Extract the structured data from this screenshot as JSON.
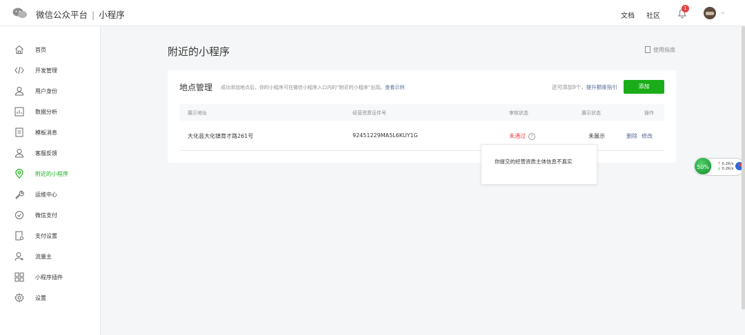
{
  "topbar": {
    "title": "微信公众平台",
    "separator": "|",
    "subtitle": "小程序",
    "docs": "文档",
    "community": "社区",
    "badge": "1"
  },
  "sidebar": {
    "items": [
      {
        "label": "首页",
        "icon": "home-icon"
      },
      {
        "label": "开发管理",
        "icon": "code-icon"
      },
      {
        "label": "用户身份",
        "icon": "user-icon"
      },
      {
        "label": "数据分析",
        "icon": "chart-icon"
      },
      {
        "label": "模板消息",
        "icon": "message-icon"
      },
      {
        "label": "客服反馈",
        "icon": "support-icon"
      },
      {
        "label": "附近的小程序",
        "icon": "location-icon",
        "active": true
      },
      {
        "label": "运维中心",
        "icon": "wrench-icon"
      },
      {
        "label": "微信支付",
        "icon": "pay-icon"
      },
      {
        "label": "支付设置",
        "icon": "pay-settings-icon"
      },
      {
        "label": "流量主",
        "icon": "traffic-icon"
      },
      {
        "label": "小程序插件",
        "icon": "plugin-icon"
      },
      {
        "label": "设置",
        "icon": "gear-icon"
      }
    ]
  },
  "page": {
    "title": "附近的小程序",
    "guide": "使用指南"
  },
  "card": {
    "title": "地点管理",
    "desc": "成功添加地点后，你的小程序可在微信小程序入口内的“附近的小程序”出现。",
    "desc_link": "查看示例",
    "quota": "还可添加9个，",
    "quota_link": "提升额度指引",
    "add_button": "添加"
  },
  "table": {
    "headers": [
      "展示地址",
      "经营资质证件号",
      "审核状态",
      "展示状态",
      "操作"
    ],
    "rows": [
      {
        "address": "大化县大化镇育才路261号",
        "license": "92451229MA5L6KUY1G",
        "review": "未通过",
        "display": "未展示",
        "delete": "删除",
        "edit": "修改"
      }
    ]
  },
  "tooltip": {
    "text": "你提交的经营资质主体信息不真实"
  },
  "netwidget": {
    "percent": "50%",
    "up": "0.2K/s",
    "down": "0.2K/s"
  },
  "colors": {
    "accent": "#1aad19",
    "link": "#576b95",
    "error": "#e64340"
  }
}
